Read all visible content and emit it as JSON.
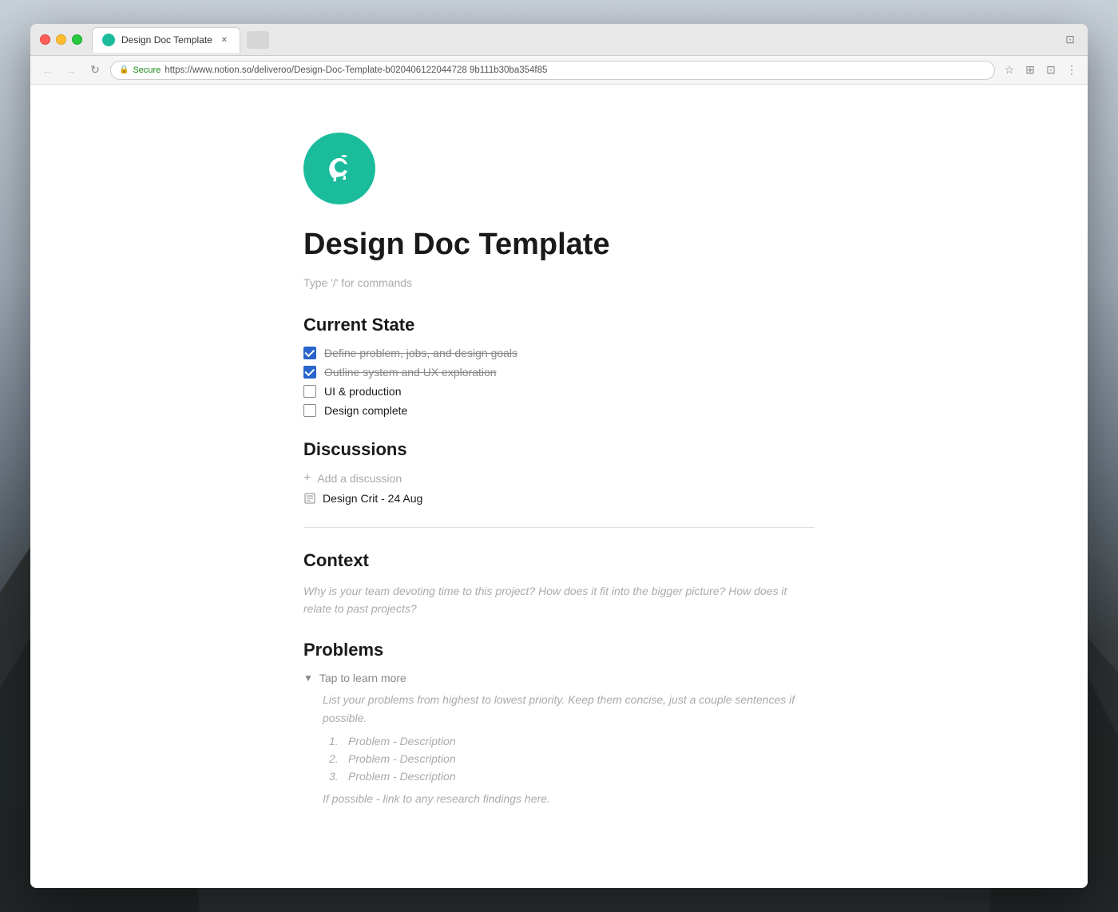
{
  "window": {
    "title": "Design Doc Template",
    "tab_label": "Design Doc Template"
  },
  "browser": {
    "url_secure_label": "Secure",
    "url": "https://www.notion.so/deliveroo/Design-Doc-Template-b020406122044728 9b111b30ba354f85",
    "back_disabled": false,
    "forward_disabled": true
  },
  "page": {
    "title": "Design Doc Template",
    "subtitle_placeholder": "Type '/' for commands",
    "sections": {
      "current_state": {
        "heading": "Current State",
        "items": [
          {
            "label": "Define problem, jobs, and design goals",
            "checked": true
          },
          {
            "label": "Outline system and UX exploration",
            "checked": true
          },
          {
            "label": "UI & production",
            "checked": false
          },
          {
            "label": "Design complete",
            "checked": false
          }
        ]
      },
      "discussions": {
        "heading": "Discussions",
        "add_label": "Add a discussion",
        "items": [
          {
            "label": "Design Crit - 24 Aug"
          }
        ]
      },
      "context": {
        "heading": "Context",
        "description": "Why is your team devoting time to this project? How does it fit into the bigger picture? How does it relate to past projects?"
      },
      "problems": {
        "heading": "Problems",
        "toggle_label": "Tap to learn more",
        "toggle_desc": "List your problems from highest to lowest priority. Keep them concise, just a couple sentences if possible.",
        "list_items": [
          "Problem - Description",
          "Problem - Description",
          "Problem - Description"
        ],
        "bottom_note": "If possible - link to any research findings here."
      }
    }
  }
}
